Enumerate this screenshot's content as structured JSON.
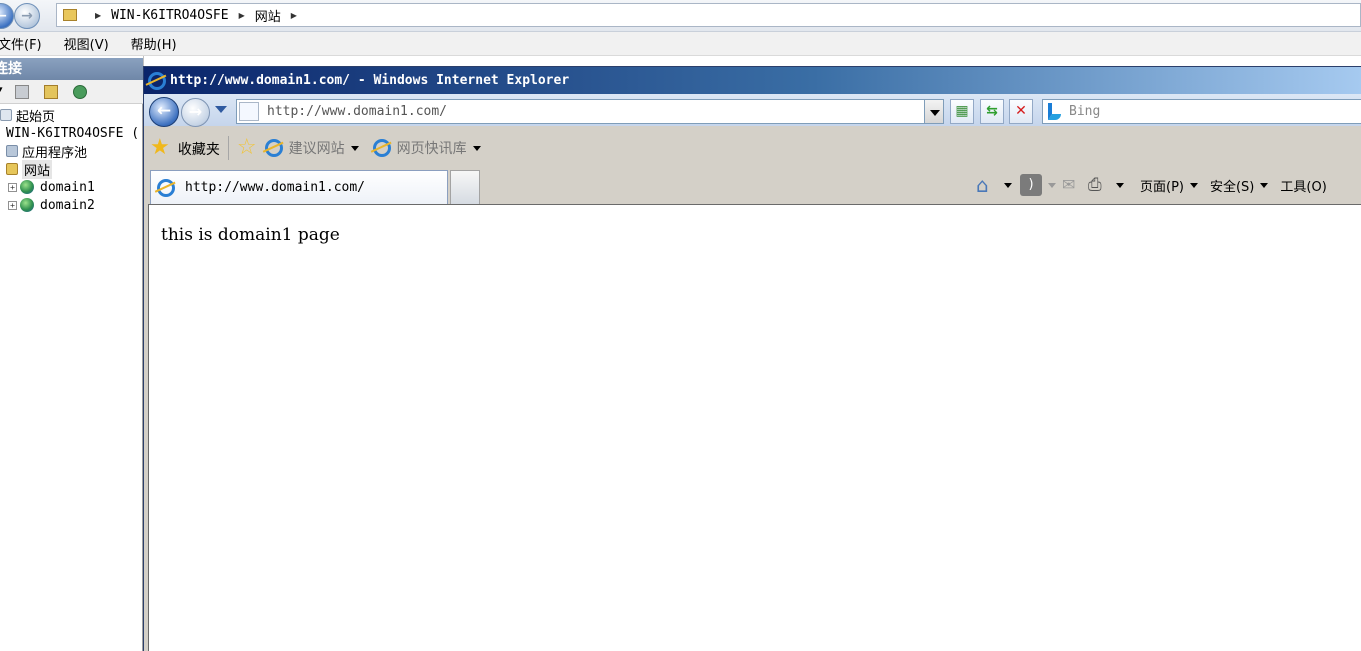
{
  "iis": {
    "breadcrumb": [
      "WIN-K6ITRO4OSFE",
      "网站"
    ],
    "menu": [
      "文件(F)",
      "视图(V)",
      "帮助(H)"
    ],
    "connections_title": "连接",
    "tree": {
      "start_page": "起始页",
      "server": "WIN-K6ITRO4OSFE (",
      "app_pools": "应用程序池",
      "sites": "网站",
      "site1": "domain1",
      "site2": "domain2"
    }
  },
  "ie": {
    "title": "http://www.domain1.com/ - Windows Internet Explorer",
    "address": "http://www.domain1.com/",
    "search_placeholder": "Bing",
    "favorites_label": "收藏夹",
    "suggested_sites": "建议网站",
    "web_slice_gallery": "网页快讯库",
    "tab_title": "http://www.domain1.com/",
    "commands": {
      "page": "页面(P)",
      "safety": "安全(S)",
      "tools": "工具(O)"
    },
    "icons": {
      "back": "back-arrow-icon",
      "forward": "forward-arrow-icon",
      "refresh": "refresh-icon",
      "stop": "stop-icon",
      "home": "home-icon",
      "feeds": "rss-icon",
      "mail": "mail-icon",
      "print": "printer-icon"
    },
    "content_text": "this is domain1 page"
  },
  "colors": {
    "ie_title_start": "#0a246a",
    "ie_title_end": "#a6caf0",
    "iis_header": "#7d95b6"
  }
}
